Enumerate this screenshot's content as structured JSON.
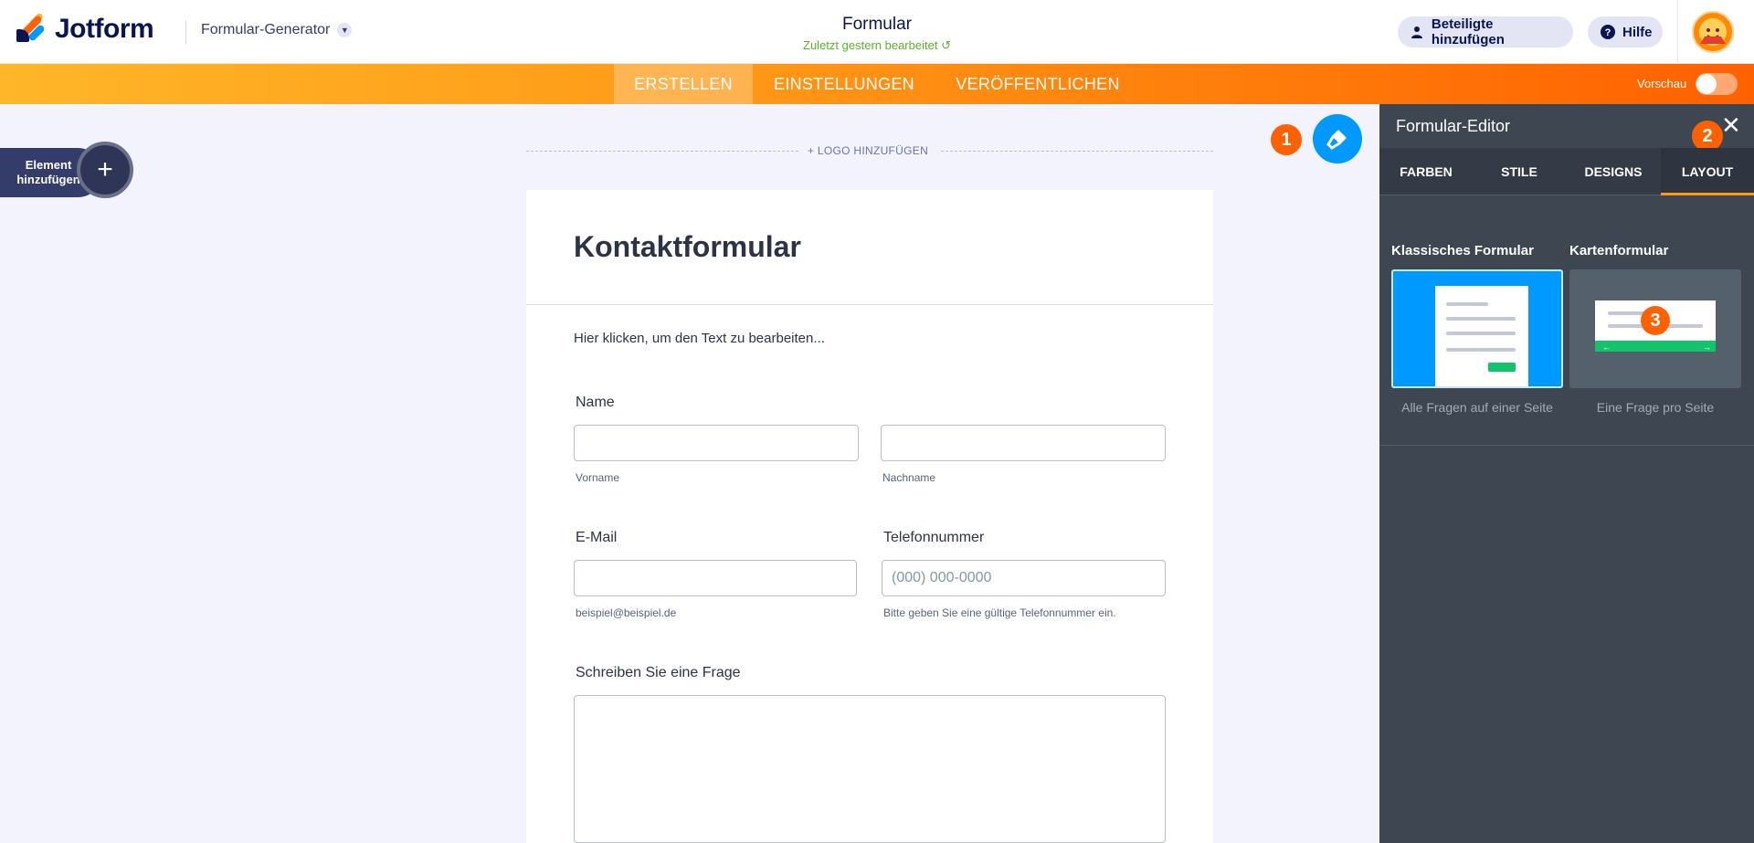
{
  "header": {
    "logo_text": "Jotform",
    "builder_menu": "Formular-Generator",
    "form_title": "Formular",
    "last_edited": "Zuletzt gestern bearbeitet",
    "collab_button": "Beteiligte hinzufügen",
    "help_button": "Hilfe"
  },
  "nav": {
    "tabs": [
      "ERSTELLEN",
      "EINSTELLUNGEN",
      "VERÖFFENTLICHEN"
    ],
    "active_tab": "ERSTELLEN",
    "preview_label": "Vorschau"
  },
  "left": {
    "add_element": "Element hinzufügen"
  },
  "canvas": {
    "logo_add": "+ LOGO HINZUFÜGEN",
    "badge_1": "1"
  },
  "form": {
    "title": "Kontaktformular",
    "description": "Hier klicken, um den Text zu bearbeiten...",
    "name_label": "Name",
    "first_name_sub": "Vorname",
    "last_name_sub": "Nachname",
    "email_label": "E-Mail",
    "email_sub": "beispiel@beispiel.de",
    "phone_label": "Telefonnummer",
    "phone_placeholder": "(000) 000-0000",
    "phone_sub": "Bitte geben Sie eine gültige Telefonnummer ein.",
    "question_label": "Schreiben Sie eine Frage"
  },
  "panel": {
    "title": "Formular-Editor",
    "tabs": [
      "FARBEN",
      "STILE",
      "DESIGNS",
      "LAYOUT"
    ],
    "active_tab": "LAYOUT",
    "badge_2": "2",
    "badge_3": "3",
    "options": [
      {
        "title": "Klassisches Formular",
        "caption": "Alle Fragen auf einer Seite"
      },
      {
        "title": "Kartenformular",
        "caption": "Eine Frage pro Seite"
      }
    ]
  },
  "colors": {
    "accent_orange": "#ff6100",
    "accent_blue": "#0099ff",
    "panel_bg": "#3e4652"
  }
}
